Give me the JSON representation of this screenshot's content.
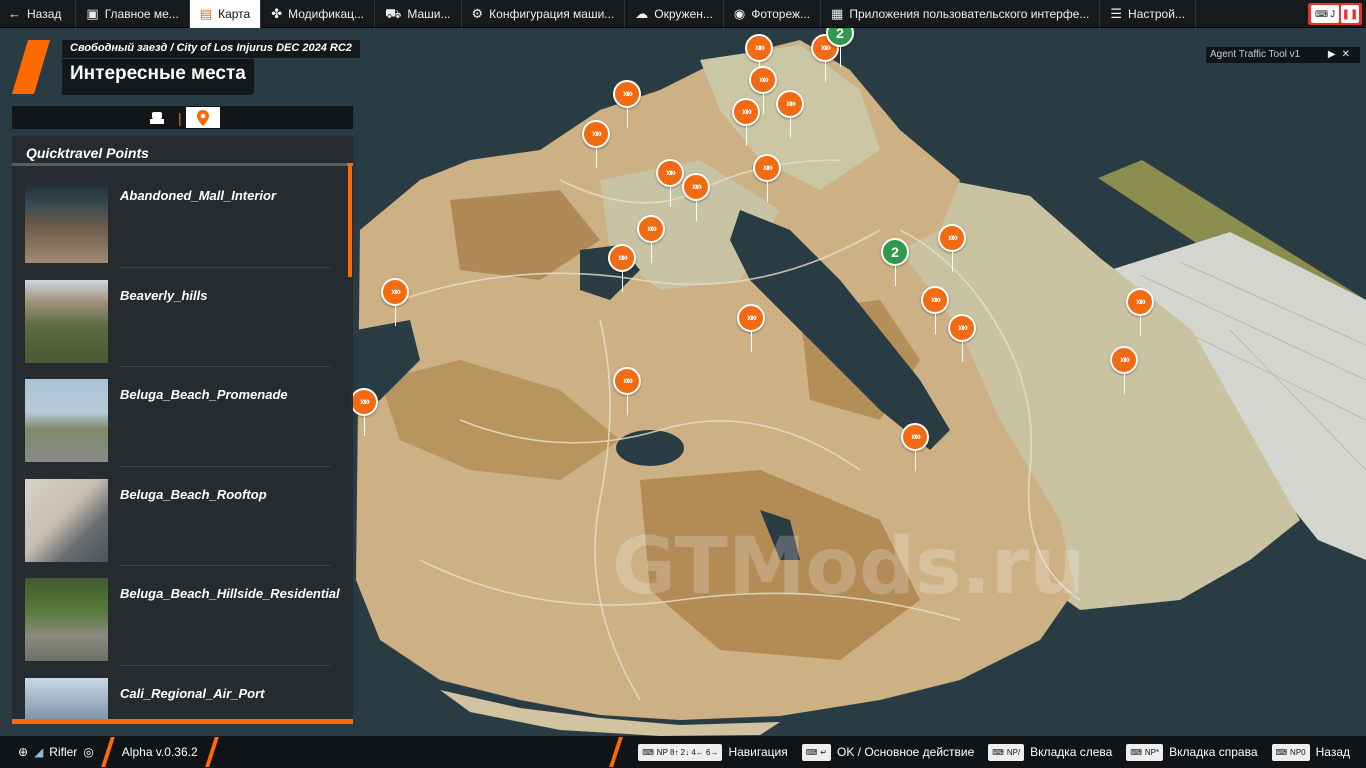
{
  "topbar": {
    "back": {
      "label": "Назад",
      "icon": "arrow-left-icon"
    },
    "tabs": [
      {
        "label": "Главное ме...",
        "icon": "main-menu-icon",
        "active": false
      },
      {
        "label": "Карта",
        "icon": "map-icon",
        "active": true
      },
      {
        "label": "Модификац...",
        "icon": "puzzle-icon",
        "active": false
      },
      {
        "label": "Маши...",
        "icon": "car-icon",
        "active": false
      },
      {
        "label": "Конфигурация маши...",
        "icon": "car-config-icon",
        "active": false
      },
      {
        "label": "Окружен...",
        "icon": "environment-icon",
        "active": false
      },
      {
        "label": "Фотореж...",
        "icon": "camera-icon",
        "active": false
      },
      {
        "label": "Приложения пользовательского интерфе...",
        "icon": "ui-apps-icon",
        "active": false
      },
      {
        "label": "Настрой...",
        "icon": "settings-icon",
        "active": false
      }
    ],
    "status_key": "J"
  },
  "header": {
    "breadcrumb": "Свободный заезд / City of Los Injurus DEC 2024 RC2",
    "title": "Интересные места"
  },
  "panel": {
    "title": "Quicktravel Points",
    "items": [
      {
        "label": "Abandoned_Mall_Interior"
      },
      {
        "label": "Beaverly_hills"
      },
      {
        "label": "Beluga_Beach_Promenade"
      },
      {
        "label": "Beluga_Beach_Rooftop"
      },
      {
        "label": "Beluga_Beach_Hillside_Residential"
      },
      {
        "label": "Cali_Regional_Air_Port"
      }
    ]
  },
  "agent_tool": {
    "title": "Agent Traffic Tool v1"
  },
  "bottombar": {
    "user": "Rifler",
    "version": "Alpha v.0.36.2",
    "hints": [
      {
        "key": "NP 8↑ 2↓ 4← 6→",
        "label": "Навигация"
      },
      {
        "key": "↵",
        "label": "OK / Основное действие"
      },
      {
        "key": "NP/",
        "label": "Вкладка слева"
      },
      {
        "key": "NP*",
        "label": "Вкладка справа"
      },
      {
        "key": "NP0",
        "label": "Назад"
      }
    ]
  },
  "map": {
    "watermark": "GTMods.ru",
    "green_marker_label": "2",
    "accent_color": "#f26a12",
    "green_color": "#2f9a4e"
  }
}
